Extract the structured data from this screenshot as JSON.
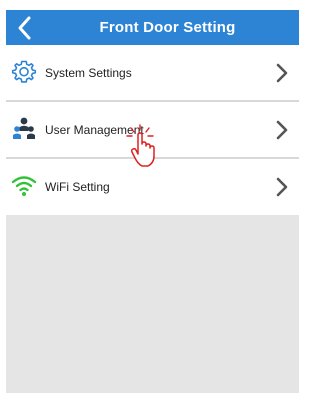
{
  "header": {
    "title": "Front Door Setting",
    "back_icon": "chevron-left-icon",
    "color": "#2e84d4"
  },
  "menu": {
    "items": [
      {
        "label": "System Settings",
        "icon": "gear-icon"
      },
      {
        "label": "User Management",
        "icon": "users-icon"
      },
      {
        "label": "WiFi Setting",
        "icon": "wifi-icon"
      }
    ],
    "chevron_icon": "chevron-right-icon"
  },
  "overlay": {
    "icon": "tap-hand-icon",
    "accent": "#e02020"
  },
  "colors": {
    "wifi": "#34c13a",
    "icon_blue": "#2e84d4",
    "icon_dark": "#2a3a4a",
    "background": "#e5e5e5"
  }
}
